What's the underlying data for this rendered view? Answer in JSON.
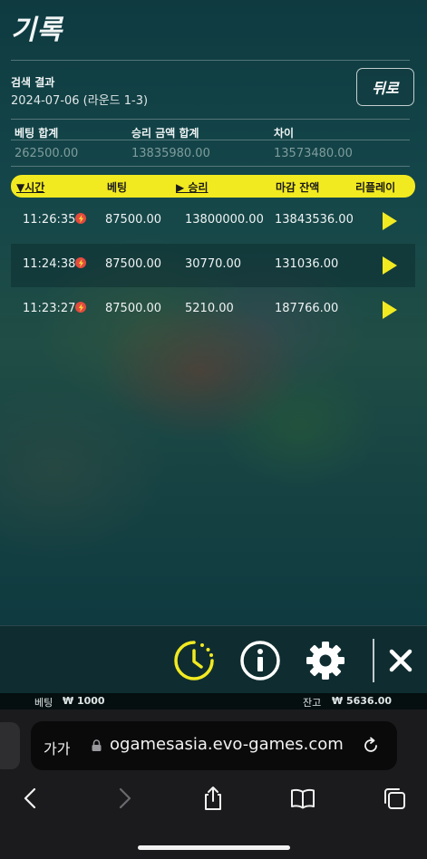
{
  "title": "기록",
  "search": {
    "label": "검색 결과",
    "value": "2024-07-06 (라운드 1-3)"
  },
  "back_button": "뒤로",
  "summary": [
    {
      "label": "베팅 합계",
      "value": "262500.00"
    },
    {
      "label": "승리 금액 합계",
      "value": "13835980.00"
    },
    {
      "label": "차이",
      "value": "13573480.00"
    }
  ],
  "table": {
    "columns": [
      "▼시간",
      "베팅",
      "▶ 승리",
      "마감 잔액",
      "리플레이"
    ],
    "rows": [
      {
        "time": "11:26:35",
        "bet": "87500.00",
        "win": "13800000.00",
        "balance": "13843536.00"
      },
      {
        "time": "11:24:38",
        "bet": "87500.00",
        "win": "30770.00",
        "balance": "131036.00"
      },
      {
        "time": "11:23:27",
        "bet": "87500.00",
        "win": "5210.00",
        "balance": "187766.00"
      }
    ]
  },
  "toolbar": {
    "icons": [
      "history-icon",
      "info-icon",
      "settings-icon",
      "close-icon"
    ]
  },
  "balance_bar": {
    "bet_label": "베팅",
    "bet_value": "₩ 1000",
    "balance_label": "잔고",
    "balance_value": "₩ 5636.00"
  },
  "browser": {
    "aa": "가가",
    "url": "ogamesasia.evo-games.com"
  },
  "colors": {
    "accent_yellow": "#f2ea21",
    "flash_red": "#e34a3d"
  }
}
